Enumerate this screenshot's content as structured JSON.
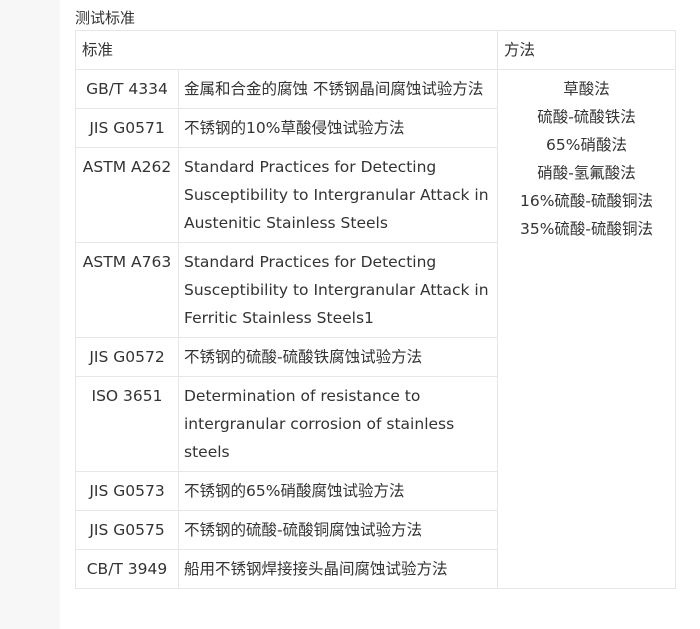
{
  "section_title": "测试标准",
  "table": {
    "headers": {
      "standard": "标准",
      "method": "方法"
    },
    "rows": [
      {
        "code": "GB/T 4334",
        "name": "金属和合金的腐蚀 不锈钢晶间腐蚀试验方法"
      },
      {
        "code": "JIS G0571",
        "name": "不锈钢的10%草酸侵蚀试验方法"
      },
      {
        "code": "ASTM A262",
        "name": "Standard Practices for Detecting Susceptibility to Intergranular Attack in Austenitic Stainless Steels"
      },
      {
        "code": "ASTM A763",
        "name": "Standard Practices for Detecting Susceptibility to Intergranular Attack in Ferritic Stainless Steels1"
      },
      {
        "code": "JIS G0572",
        "name": "不锈钢的硫酸-硫酸铁腐蚀试验方法"
      },
      {
        "code": "ISO 3651",
        "name": "Determination of resistance to intergranular corrosion of stainless steels"
      },
      {
        "code": "JIS G0573",
        "name": "不锈钢的65%硝酸腐蚀试验方法"
      },
      {
        "code": "JIS G0575",
        "name": "不锈钢的硫酸-硫酸铜腐蚀试验方法"
      },
      {
        "code": "CB/T 3949",
        "name": "船用不锈钢焊接接头晶间腐蚀试验方法"
      }
    ],
    "methods": [
      "草酸法",
      "硫酸-硫酸铁法",
      "65%硝酸法",
      "硝酸-氢氟酸法",
      "16%硫酸-硫酸铜法",
      "35%硫酸-硫酸铜法"
    ]
  }
}
